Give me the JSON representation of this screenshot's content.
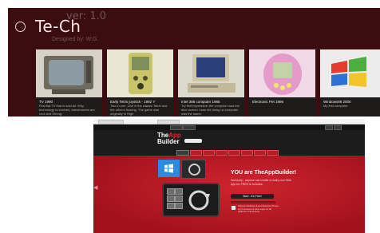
{
  "app": {
    "title": "Te-Ch",
    "version": "ver: 1.0",
    "designer": "Designed by: W.G."
  },
  "tiles": [
    {
      "title": "TV 1990",
      "desc": "First flat TV that is sold all. Why technology is evolved, transformers are cool and Strong."
    },
    {
      "title": "Early Tetris joystick - 1992 Y",
      "desc": "Two in one. One is the classic Tetris and the other's flouring. The game was originally in High"
    },
    {
      "title": "Intel 386 computer 1985",
      "desc": "Try find impression the computer was the blue screen I was kid doing on computer was the same."
    },
    {
      "title": "Electronic Pet 1996",
      "desc": ""
    },
    {
      "title": "Windows98 2000",
      "desc": "My first computer."
    }
  ],
  "browser": {
    "logo_line1": "The",
    "logo_line2": "App",
    "logo_line3": "Builder",
    "headline": "YOU are TheAppBuilder!",
    "subtext": "Seriously - anyone can create a really cool Web App for FREE in minutes.",
    "start_button": "Start - it's Free!",
    "badge_text": "Support Windows 8 and Windows Phone, and hundreds of other apps for all platforms and devices"
  },
  "colors": {
    "app_background": "#3c0d10",
    "browser_red": "#c11a24",
    "windows_blue": "#2b8be0"
  }
}
